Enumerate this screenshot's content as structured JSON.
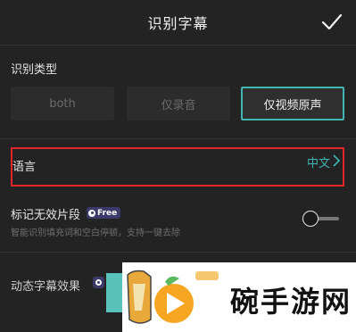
{
  "header": {
    "title": "识别字幕"
  },
  "type_section": {
    "label": "识别类型",
    "options": [
      {
        "label": "both",
        "selected": false
      },
      {
        "label": "仅录音",
        "selected": false
      },
      {
        "label": "仅视频原声",
        "selected": true
      }
    ]
  },
  "language": {
    "label": "语言",
    "value": "中文"
  },
  "invalid_segments": {
    "label": "标记无效片段",
    "badge": "Free",
    "hint": "智能识别填充词和空白停顿，支持一键去除",
    "toggle_on": false
  },
  "animation": {
    "label": "动态字幕效果"
  },
  "watermark": {
    "text": "碗手游网"
  },
  "colors": {
    "accent": "#3fb6b2",
    "highlight_border": "#e2262b",
    "badge_bg": "#3c3a6a"
  }
}
